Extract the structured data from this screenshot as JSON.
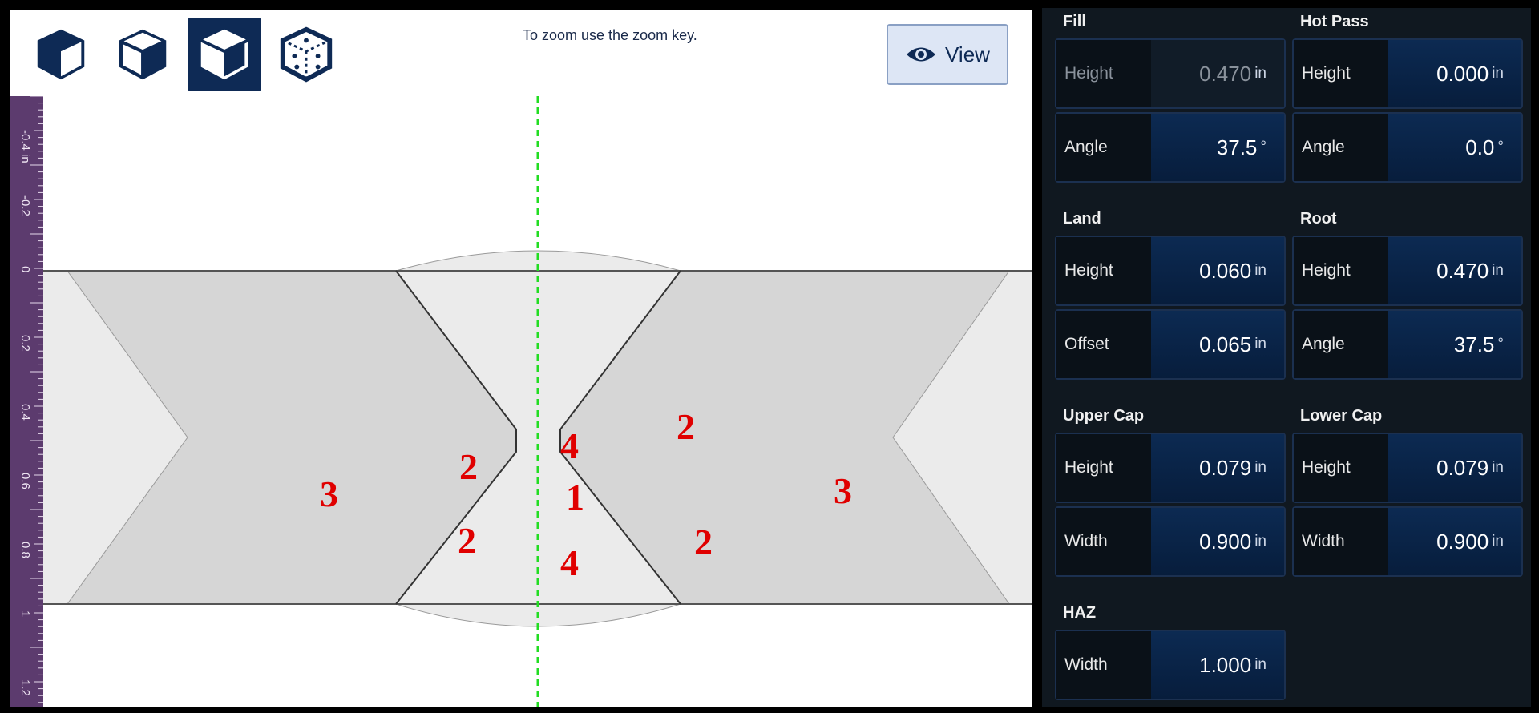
{
  "toolbar": {
    "views": [
      {
        "name": "solid-cube-view",
        "active": false
      },
      {
        "name": "shaded-cube-view",
        "active": false
      },
      {
        "name": "highlight-cube-view",
        "active": true
      },
      {
        "name": "dotted-cube-view",
        "active": false
      }
    ],
    "zoom_hint": "To zoom use the zoom key.",
    "view_button_label": "View"
  },
  "ruler": {
    "labels": [
      "-0.4 in",
      "-0.2",
      "0",
      "0.2",
      "0.4",
      "0.6",
      "0.8",
      "1",
      "1.2"
    ]
  },
  "zone_labels": [
    "3",
    "2",
    "2",
    "4",
    "1",
    "4",
    "2",
    "2",
    "3"
  ],
  "panel": {
    "fill": {
      "title": "Fill",
      "height_label": "Height",
      "height_value": "0.470",
      "height_unit": "in",
      "angle_label": "Angle",
      "angle_value": "37.5",
      "angle_unit": "°"
    },
    "hot_pass": {
      "title": "Hot Pass",
      "height_label": "Height",
      "height_value": "0.000",
      "height_unit": "in",
      "angle_label": "Angle",
      "angle_value": "0.0",
      "angle_unit": "°"
    },
    "land": {
      "title": "Land",
      "height_label": "Height",
      "height_value": "0.060",
      "height_unit": "in",
      "offset_label": "Offset",
      "offset_value": "0.065",
      "offset_unit": "in"
    },
    "root": {
      "title": "Root",
      "height_label": "Height",
      "height_value": "0.470",
      "height_unit": "in",
      "angle_label": "Angle",
      "angle_value": "37.5",
      "angle_unit": "°"
    },
    "upper_cap": {
      "title": "Upper Cap",
      "height_label": "Height",
      "height_value": "0.079",
      "height_unit": "in",
      "width_label": "Width",
      "width_value": "0.900",
      "width_unit": "in"
    },
    "lower_cap": {
      "title": "Lower Cap",
      "height_label": "Height",
      "height_value": "0.079",
      "height_unit": "in",
      "width_label": "Width",
      "width_value": "0.900",
      "width_unit": "in"
    },
    "haz": {
      "title": "HAZ",
      "width_label": "Width",
      "width_value": "1.000",
      "width_unit": "in"
    }
  },
  "colors": {
    "centerline": "#22dd22",
    "zone_label": "#e00000",
    "active_view": "#0e2a55",
    "plate": "#d6d6d6",
    "bevel": "#ebebeb"
  }
}
